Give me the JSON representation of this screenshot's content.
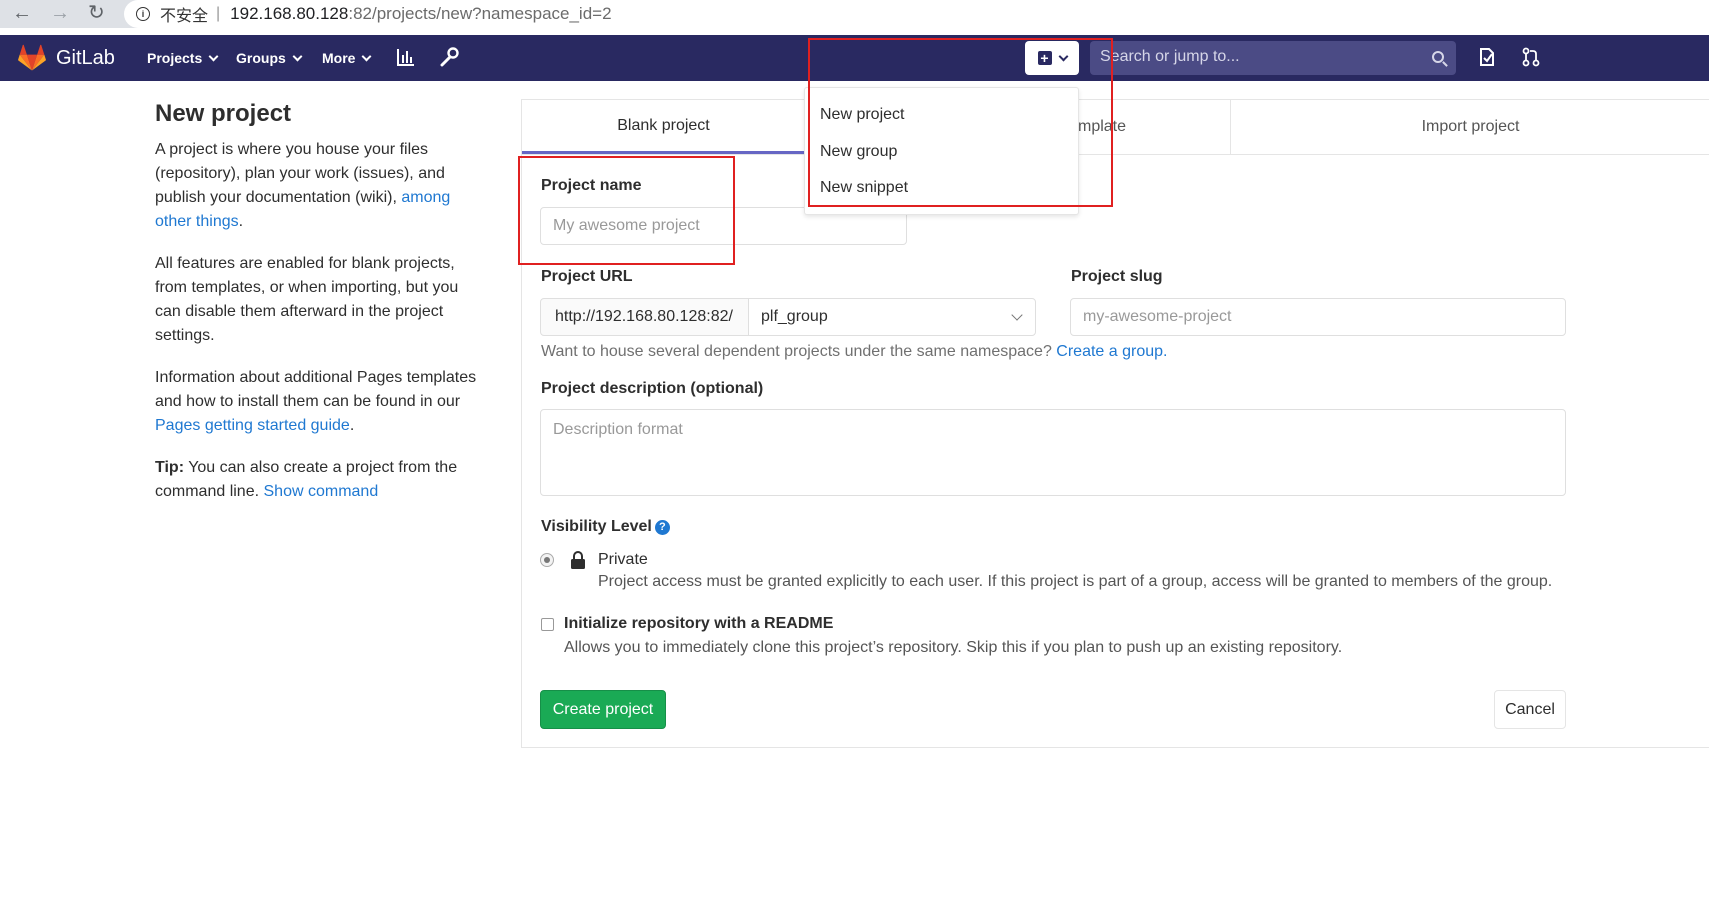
{
  "browser": {
    "insecure_label": "不安全",
    "url_host": "192.168.80.128",
    "url_rest": ":82/projects/new?namespace_id=2"
  },
  "header": {
    "brand": "GitLab",
    "nav": [
      "Projects",
      "Groups",
      "More"
    ],
    "search_placeholder": "Search or jump to...",
    "bg_color": "#292961"
  },
  "new_menu": {
    "items": [
      "New project",
      "New group",
      "New snippet"
    ]
  },
  "sidebar": {
    "title": "New project",
    "p1_text": "A project is where you house your files (repository), plan your work (issues), and publish your documentation (wiki),",
    "p1_link": "among other things",
    "p1_end": ".",
    "p2_text": "All features are enabled for blank projects, from templates, or when importing, but you can disable them afterward in the project settings.",
    "p3_text": "Information about additional Pages templates and how to install them can be found in our",
    "p3_link": "Pages getting started guide",
    "p3_end": ".",
    "tip_label": "Tip:",
    "tip_text": "You can also create a project from the command line.",
    "tip_link": "Show command"
  },
  "tabs": {
    "blank": "Blank project",
    "template_partial": "mplate",
    "import": "Import project"
  },
  "form": {
    "project_name_label": "Project name",
    "project_name_placeholder": "My awesome project",
    "project_url_label": "Project URL",
    "url_prefix": "http://192.168.80.128:82/",
    "namespace": "plf_group",
    "project_slug_label": "Project slug",
    "project_slug_placeholder": "my-awesome-project",
    "help_text": "Want to house several dependent projects under the same namespace?",
    "help_link": "Create a group.",
    "description_label": "Project description (optional)",
    "description_placeholder": "Description format",
    "visibility_label": "Visibility Level",
    "private_label": "Private",
    "private_desc": "Project access must be granted explicitly to each user. If this project is part of a group, access will be granted to members of the group.",
    "readme_label": "Initialize repository with a README",
    "readme_desc": "Allows you to immediately clone this project’s repository. Skip this if you plan to push up an existing repository.",
    "create_button": "Create project",
    "cancel_button": "Cancel",
    "create_color": "#1aaa55"
  }
}
